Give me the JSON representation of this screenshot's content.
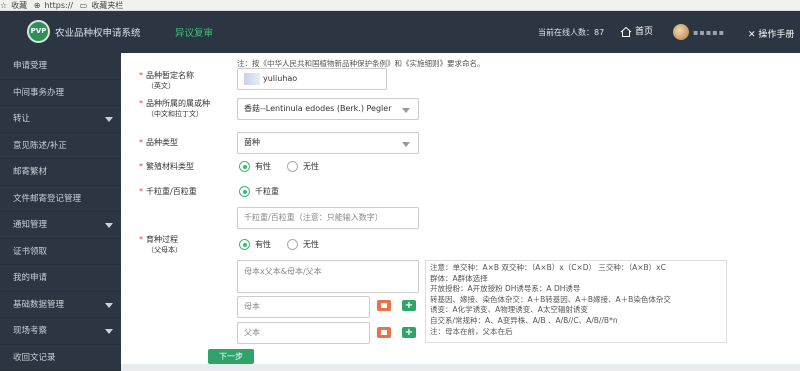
{
  "browser": {
    "favorites": "收藏",
    "url": "https://",
    "bookmarks": "收藏夹栏"
  },
  "header": {
    "logo_text": "PVP",
    "app_title": "农业品种权申请系统",
    "nav_link": "异议复审",
    "online_users": "当前在线人数：87",
    "home": "首页",
    "username": "▪▪▪▪▪",
    "manual": "操作手册"
  },
  "sidebar": {
    "items": [
      {
        "label": "申请受理",
        "expandable": false
      },
      {
        "label": "中间事务办理",
        "expandable": false
      },
      {
        "label": "转让",
        "expandable": true
      },
      {
        "label": "意见陈述/补正",
        "expandable": false
      },
      {
        "label": "邮寄繁材",
        "expandable": false
      },
      {
        "label": "文件邮寄登记管理",
        "expandable": false
      },
      {
        "label": "通知管理",
        "expandable": true
      },
      {
        "label": "证书领取",
        "expandable": false
      },
      {
        "label": "我的申请",
        "expandable": false
      },
      {
        "label": "基础数据管理",
        "expandable": true
      },
      {
        "label": "现场考察",
        "expandable": true
      },
      {
        "label": "收回文记录",
        "expandable": false
      }
    ]
  },
  "form": {
    "top_note": "注：按《中华人民共和国植物新品种保护条例》和《实施细则》要求命名。",
    "variety_name": {
      "label": "品种暂定名称",
      "sub": "（英文）",
      "value": "yuliuhao"
    },
    "genus_species": {
      "label": "品种所属的属或种",
      "sub": "（中文和拉丁文）",
      "value": "香菇--Lentinula edodes (Berk.) Pegler"
    },
    "variety_type": {
      "label": "品种类型",
      "value": "菌种"
    },
    "propagation_type": {
      "label": "繁殖材料类型",
      "options": [
        "有性",
        "无性"
      ],
      "selected": 0
    },
    "seed_weight": {
      "label": "千粒重/百粒重",
      "option": "千粒重",
      "placeholder": "千粒重/百粒重（注意：只能输入数字）"
    },
    "breeding_process": {
      "label": "育种过程",
      "sub": "（父母本）",
      "options": [
        "有性",
        "无性"
      ],
      "selected": 0,
      "cross_placeholder": "母本x父本&母本/父本",
      "female_placeholder": "母本",
      "male_placeholder": "父本"
    },
    "notes": [
      "注意：单交种：A×B    双交种：（A×B）x（C×D）         三交种：（A×B）xC",
      "群体：A群体选择",
      "开放授粉：A开放授粉             DH诱导系：A DH诱导",
      "转基因、嫁接、染色体杂交：A＋B转基因、A＋B嫁接、A＋B染色体杂交",
      "诱变：A化学诱变、A物理诱变、A太空辐射诱变",
      "自交系/常规种：A、A变异株、A/B 、A/B//C、A/B//B*n",
      "注：母本在前，父本在后"
    ],
    "next_button": "下一步"
  }
}
